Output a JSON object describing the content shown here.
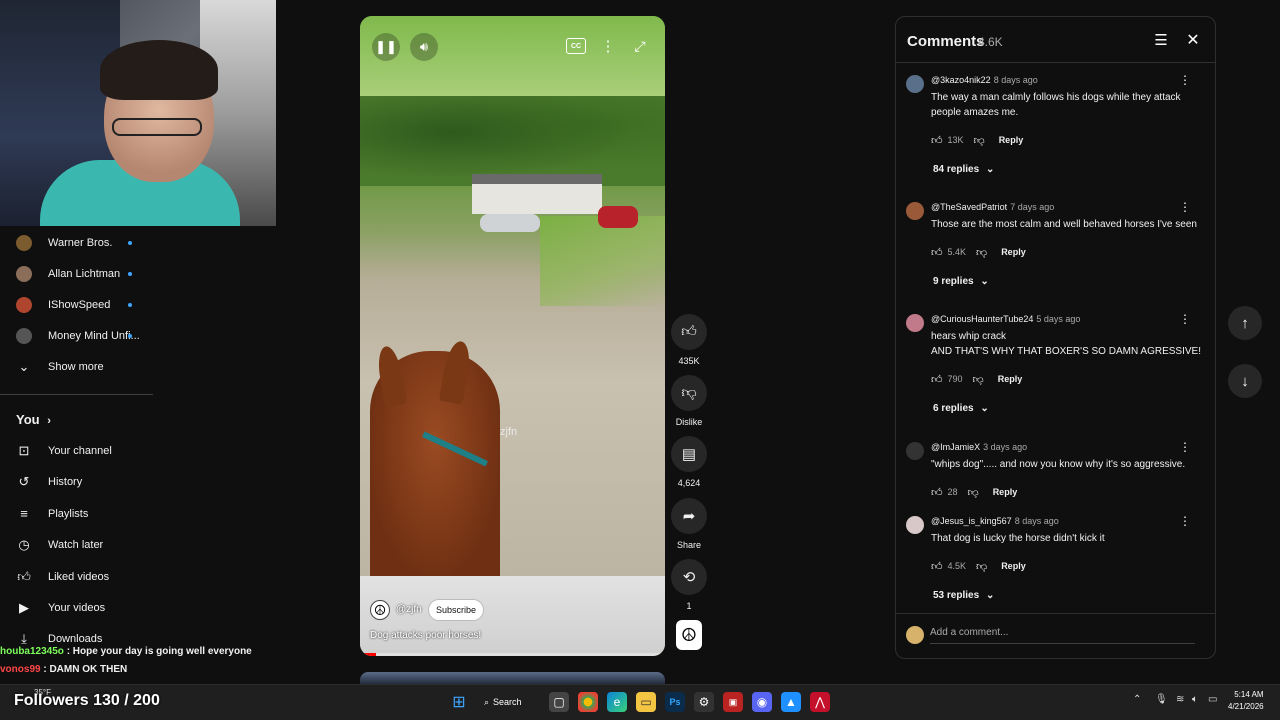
{
  "sidebar": {
    "subscriptions": [
      {
        "label": "Warner Bros.",
        "avatar_color": "#7a5c2e"
      },
      {
        "label": "Allan Lichtman",
        "avatar_color": "#8a6e5a"
      },
      {
        "label": "IShowSpeed",
        "avatar_color": "#b0452f"
      },
      {
        "label": "Money Mind Unfi...",
        "avatar_color": "#555555"
      }
    ],
    "show_more": "Show more",
    "you_header": "You",
    "you_items": [
      {
        "label": "Your channel",
        "icon": "person-square-icon"
      },
      {
        "label": "History",
        "icon": "history-icon"
      },
      {
        "label": "Playlists",
        "icon": "playlist-icon"
      },
      {
        "label": "Watch later",
        "icon": "clock-icon"
      },
      {
        "label": "Liked videos",
        "icon": "thumbs-up-icon"
      },
      {
        "label": "Your videos",
        "icon": "video-icon"
      },
      {
        "label": "Downloads",
        "icon": "download-icon"
      }
    ]
  },
  "chat": [
    {
      "user": "houba12345o",
      "text": " : Hope your day is going well everyone",
      "color": "#7cff5a"
    },
    {
      "user": "vonos99",
      "text": " : DAMN OK THEN",
      "color": "#ff4747"
    }
  ],
  "overlay": {
    "followers": "Followers 130 / 200",
    "weather": "35°F"
  },
  "short": {
    "watermark": "zjfn",
    "channel": "@zjfn",
    "subscribe": "Subscribe",
    "title": "Dog attacks poor horses!",
    "progress": 0.04,
    "actions": {
      "likes": "435K",
      "dislike": "Dislike",
      "comments": "4,624",
      "share": "Share",
      "remix": "1"
    }
  },
  "comments_panel": {
    "title": "Comments",
    "count": "4.6K",
    "add_placeholder": "Add a comment...",
    "items": [
      {
        "user": "@3kazo4nik22",
        "ago": "8 days ago",
        "text": "The way a man calmly follows his dogs while they attack people amazes me.",
        "likes": "13K",
        "replies": "84 replies",
        "avatar_color": "#5a6f8a"
      },
      {
        "user": "@TheSavedPatriot",
        "ago": "7 days ago",
        "text": "Those are the most calm and well behaved horses I've seen",
        "likes": "5.4K",
        "replies": "9 replies",
        "avatar_color": "#9a5a3a"
      },
      {
        "user": "@CuriousHaunterTube24",
        "ago": "5 days ago",
        "text": "hears whip crack\nAND THAT'S WHY THAT BOXER'S SO DAMN AGRESSIVE!",
        "likes": "790",
        "replies": "6 replies",
        "avatar_color": "#c07a8a"
      },
      {
        "user": "@ImJamieX",
        "ago": "3 days ago",
        "text": "\"whips dog\"..... and now you know why it's so aggressive.",
        "likes": "28",
        "replies": "",
        "avatar_color": "#333333"
      },
      {
        "user": "@Jesus_is_king567",
        "ago": "8 days ago",
        "text": "That dog is lucky the horse didn't kick it",
        "likes": "4.5K",
        "replies": "53 replies",
        "avatar_color": "#d8c8c8"
      }
    ],
    "reply_label": "Reply"
  },
  "taskbar": {
    "search": "Search",
    "time": "5:14 AM",
    "date": "4/21/2026"
  }
}
